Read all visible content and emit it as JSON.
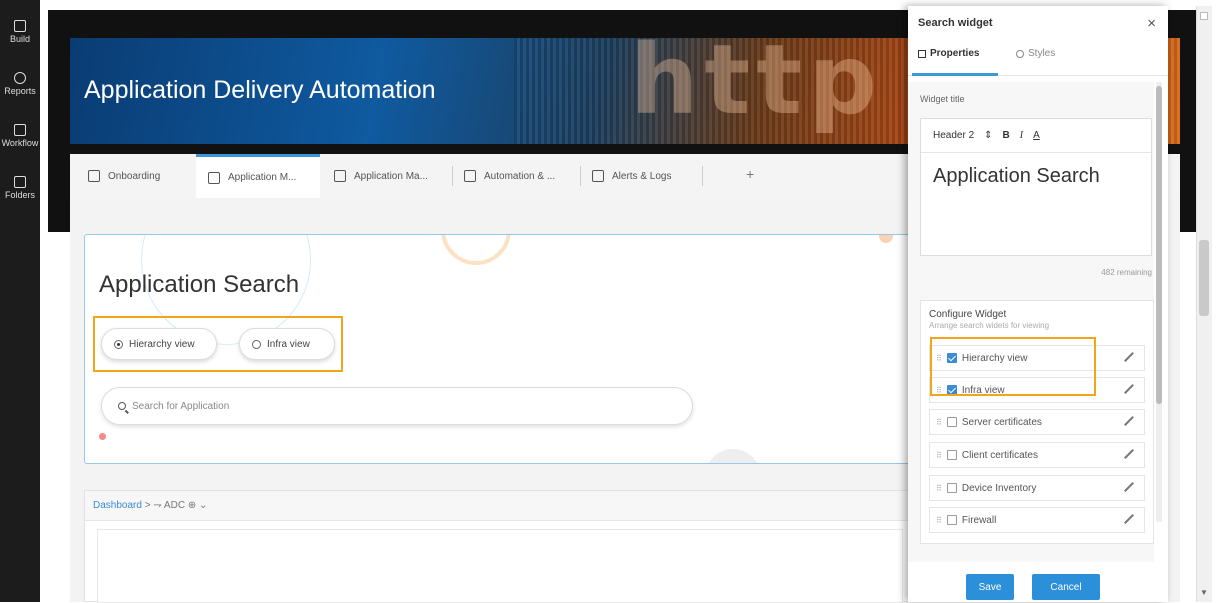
{
  "sidebar": {
    "items": [
      {
        "label": "Build",
        "icon": "build-icon"
      },
      {
        "label": "Reports",
        "icon": "reports-icon"
      },
      {
        "label": "Workflow",
        "icon": "workflow-icon"
      },
      {
        "label": "Folders",
        "icon": "folders-icon"
      }
    ]
  },
  "banner": {
    "title": "Application Delivery Automation",
    "decor": "http"
  },
  "tabs": [
    {
      "label": "Onboarding"
    },
    {
      "label": "Application M..."
    },
    {
      "label": "Application Ma..."
    },
    {
      "label": "Automation & ..."
    },
    {
      "label": "Alerts & Logs"
    }
  ],
  "tab_add": "+",
  "search_widget": {
    "title": "Application Search",
    "views": [
      {
        "label": "Hierarchy view",
        "selected": true
      },
      {
        "label": "Infra view",
        "selected": false
      }
    ],
    "search_placeholder": "Search for Application"
  },
  "dashboard": {
    "breadcrumb_link": "Dashboard",
    "breadcrumb_rest": " > ⇁ ADC ⊕ ⌄"
  },
  "panel": {
    "title": "Search widget",
    "close": "×",
    "tabs": {
      "properties": "Properties",
      "styles": "Styles"
    },
    "widget_title_label": "Widget title",
    "editor": {
      "heading_select": "Header 2",
      "select_arrow": "⇕",
      "bold": "B",
      "italic": "I",
      "underline": "A"
    },
    "editor_text": "Application Search",
    "remaining": "482 remaining",
    "configure_title": "Configure Widget",
    "configure_sub": "Arrange search widets for viewing",
    "widgets": [
      {
        "label": "Hierarchy view",
        "checked": true
      },
      {
        "label": "Infra view",
        "checked": true
      },
      {
        "label": "Server certificates",
        "checked": false
      },
      {
        "label": "Client certificates",
        "checked": false
      },
      {
        "label": "Device Inventory",
        "checked": false
      },
      {
        "label": "Firewall",
        "checked": false
      }
    ],
    "save": "Save",
    "cancel": "Cancel"
  },
  "colors": {
    "accent": "#2b8fd9",
    "highlight": "#f0a51a",
    "rail": "#1c1c1c"
  }
}
